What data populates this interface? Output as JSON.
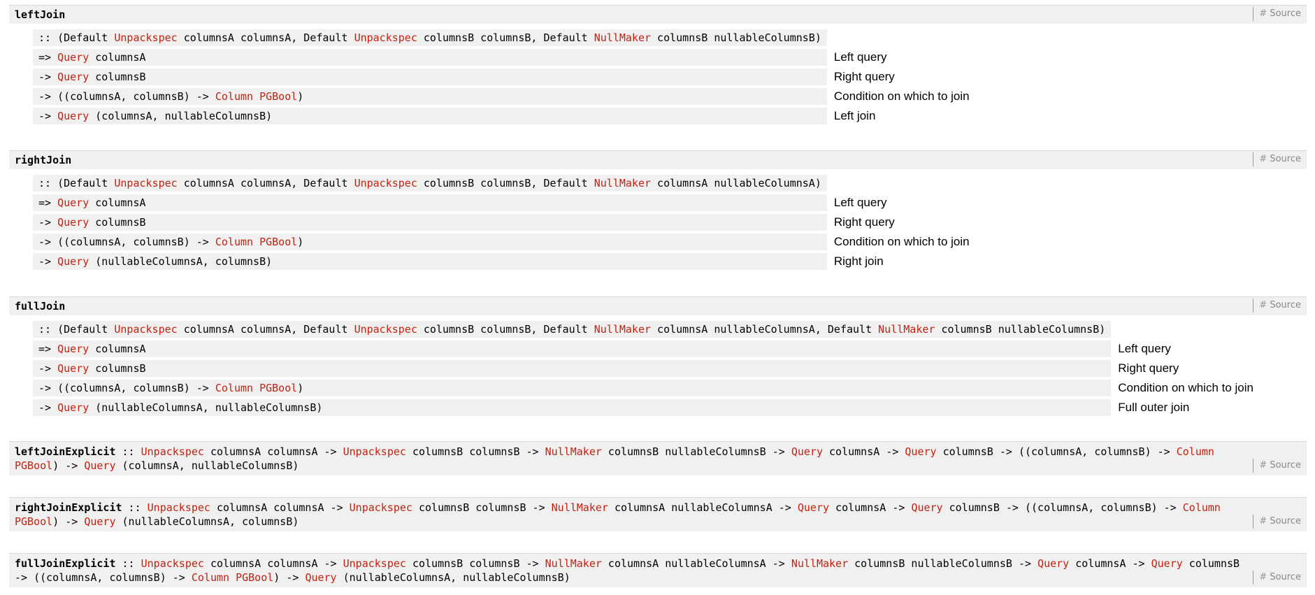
{
  "source_label": "Source",
  "source_hash": "#",
  "left_join": {
    "name": "leftJoin",
    "constraint": {
      "p1": ":: (Default ",
      "t1": "Unpackspec",
      "p2": " columnsA columnsA, Default ",
      "t2": "Unpackspec",
      "p3": " columnsB columnsB, Default ",
      "t3": "NullMaker",
      "p4": " columnsB nullableColumnsB)"
    },
    "rows": [
      {
        "arrow": "=> ",
        "type": "Query",
        "rest": " columnsA",
        "doc": "Left query"
      },
      {
        "arrow": "-> ",
        "type": "Query",
        "rest": " columnsB",
        "doc": "Right query"
      },
      {
        "pre": "-> ((columnsA, columnsB) -> ",
        "type": "Column PGBool",
        "rest": ")",
        "doc": "Condition on which to join"
      },
      {
        "arrow": "-> ",
        "type": "Query",
        "rest": " (columnsA, nullableColumnsB)",
        "doc": "Left join"
      }
    ]
  },
  "right_join": {
    "name": "rightJoin",
    "constraint": {
      "p1": ":: (Default ",
      "t1": "Unpackspec",
      "p2": " columnsA columnsA, Default ",
      "t2": "Unpackspec",
      "p3": " columnsB columnsB, Default ",
      "t3": "NullMaker",
      "p4": " columnsA nullableColumnsA)"
    },
    "rows": [
      {
        "arrow": "=> ",
        "type": "Query",
        "rest": " columnsA",
        "doc": "Left query"
      },
      {
        "arrow": "-> ",
        "type": "Query",
        "rest": " columnsB",
        "doc": "Right query"
      },
      {
        "pre": "-> ((columnsA, columnsB) -> ",
        "type": "Column PGBool",
        "rest": ")",
        "doc": "Condition on which to join"
      },
      {
        "arrow": "-> ",
        "type": "Query",
        "rest": " (nullableColumnsA, columnsB)",
        "doc": "Right join"
      }
    ]
  },
  "full_join": {
    "name": "fullJoin",
    "constraint": {
      "p1": ":: (Default ",
      "t1": "Unpackspec",
      "p2": " columnsA columnsA, Default ",
      "t2": "Unpackspec",
      "p3": " columnsB columnsB, Default ",
      "t3": "NullMaker",
      "p4": " columnsA nullableColumnsA, Default ",
      "t4": "NullMaker",
      "p5": " columnsB nullableColumnsB)"
    },
    "rows": [
      {
        "arrow": "=> ",
        "type": "Query",
        "rest": " columnsA",
        "doc": "Left query"
      },
      {
        "arrow": "-> ",
        "type": "Query",
        "rest": " columnsB",
        "doc": "Right query"
      },
      {
        "pre": "-> ((columnsA, columnsB) -> ",
        "type": "Column PGBool",
        "rest": ")",
        "doc": "Condition on which to join"
      },
      {
        "arrow": "-> ",
        "type": "Query",
        "rest": " (nullableColumnsA, nullableColumnsB)",
        "doc": "Full outer join"
      }
    ]
  },
  "left_join_explicit": {
    "name": "leftJoinExplicit",
    "s1": " :: ",
    "t1": "Unpackspec",
    "s2": " columnsA columnsA -> ",
    "t2": "Unpackspec",
    "s3": " columnsB columnsB -> ",
    "t3": "NullMaker",
    "s4": " columnsB nullableColumnsB -> ",
    "t4": "Query",
    "s5": " columnsA -> ",
    "t5": "Query",
    "s6": " columnsB -> ((columnsA, columnsB) -> ",
    "t6": "Column PGBool",
    "s7": ") -> ",
    "t7": "Query",
    "s8": " (columnsA, nullableColumnsB)"
  },
  "right_join_explicit": {
    "name": "rightJoinExplicit",
    "s1": " :: ",
    "t1": "Unpackspec",
    "s2": " columnsA columnsA -> ",
    "t2": "Unpackspec",
    "s3": " columnsB columnsB -> ",
    "t3": "NullMaker",
    "s4": " columnsA nullableColumnsA -> ",
    "t4": "Query",
    "s5": " columnsA -> ",
    "t5": "Query",
    "s6": " columnsB -> ((columnsA, columnsB) -> ",
    "t6": "Column PGBool",
    "s7": ") -> ",
    "t7": "Query",
    "s8": " (nullableColumnsA, columnsB)"
  },
  "full_join_explicit": {
    "name": "fullJoinExplicit",
    "s1": " :: ",
    "t1": "Unpackspec",
    "s2": " columnsA columnsA -> ",
    "t2": "Unpackspec",
    "s3": " columnsB columnsB -> ",
    "t3": "NullMaker",
    "s4": " columnsA nullableColumnsA -> ",
    "t4": "NullMaker",
    "s5": " columnsB nullableColumnsB -> ",
    "t5": "Query",
    "s6": " columnsA -> ",
    "t6": "Query",
    "s7": " columnsB -> ((columnsA, columnsB) -> ",
    "t7": "Column PGBool",
    "s8": ") -> ",
    "t8": "Query",
    "s9": " (nullableColumnsA, nullableColumnsB)"
  }
}
